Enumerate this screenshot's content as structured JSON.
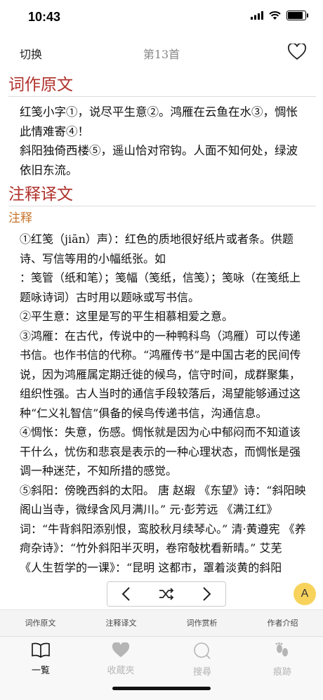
{
  "status": {
    "time": "10:43",
    "battery_level": 0.95
  },
  "nav": {
    "left_label": "切换",
    "title": "第13首"
  },
  "poem": {
    "section_title": "词作原文",
    "lines": [
      "红笺小字①，说尽平生意②。鸿雁在云鱼在水③，惆怅此情难寄④！",
      "斜阳独倚西楼⑤，遥山恰对帘钩。人面不知何处，绿波依旧东流。"
    ]
  },
  "annotation": {
    "section_title": "注释译文",
    "sub_title": "注释",
    "notes": [
      "①红笺（jiān）声）：红色的质地很好纸片或者条。供题诗、写信等用的小幅纸张。如\n：笺管（纸和笔）；笺幅（笺纸，信笺）；笺咏（在笺纸上题咏诗词）古时用以题咏或写书信。",
      "②平生意：这里是写的平生相慕相爱之意。",
      "③鸿雁：在古代，传说中的一种鸭科鸟（鸿雁）可以传递书信。也作书信的代称。“鸿雁传书”是中国古老的民间传说，因为鸿雁属定期迁徙的候鸟，信守时间，成群聚集，组织性强。古人当时的通信手段较落后，渴望能够通过这种“仁义礼智信”俱备的候鸟传递书信，沟通信息。",
      "④惆怅：失意，伤感。惆怅就是因为心中郁闷而不知道该干什么，忧伤和悲哀是表示的一种心理状态，而惆怅是强调一种迷茫，不知所措的感觉。",
      "⑤斜阳：傍晚西斜的太阳。 唐 赵嘏 《东望》诗：“斜阳映阁山当寺，微绿含风月满川。” 元·彭芳远 《满江红》词：“牛背斜阳添别恨，鸾胶秋月续琴心。” 清·黄遵宪 《养疴杂诗》：“竹外斜阳半灭明，卷帘敧枕看新晴。” 艾芜 《人生哲学的一课》：“昆明 这都市，罩着淡黄的斜阳"
    ]
  },
  "fab_label": "A",
  "subtabs": [
    "词作原文",
    "注释译文",
    "词作赏析",
    "作者介绍"
  ],
  "tabs": [
    {
      "label": "一覧",
      "icon": "book-icon",
      "active": true
    },
    {
      "label": "收蔵夾",
      "icon": "heart-filled-icon",
      "active": false
    },
    {
      "label": "搜尋",
      "icon": "search-icon",
      "active": false
    },
    {
      "label": "痕跡",
      "icon": "footprints-icon",
      "active": false
    }
  ],
  "colors": {
    "accent_red": "#b0312c",
    "accent_orange": "#c8742b",
    "fab_yellow": "#f7d35c",
    "inactive_tab": "#b5b5b5"
  }
}
